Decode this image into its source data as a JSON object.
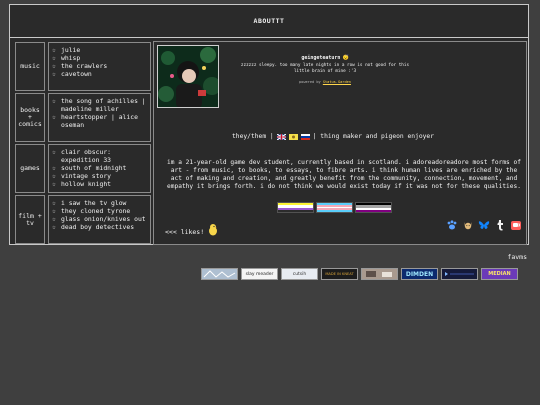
{
  "title": "ABOUTTT",
  "categories": [
    {
      "label": "music",
      "items": [
        "julie",
        "whisp",
        "the crawlers",
        "cavetown"
      ]
    },
    {
      "label": "books + comics",
      "items": [
        "the song of achilles | madeline miller",
        "heartstopper | alice oseman"
      ]
    },
    {
      "label": "games",
      "items": [
        "clair obscur: expedition 33",
        "south of midnight",
        "vintage story",
        "hollow knight"
      ]
    },
    {
      "label": "film + tv",
      "items": [
        "i saw the tv glow",
        "they cloned tyrone",
        "glass onion/knives out",
        "dead boy detectives"
      ]
    }
  ],
  "star_glyph": "☆",
  "status": {
    "username": "geingeteaturn",
    "emoji": "😴",
    "message": "zzzzzz sleepy. too many late nights in a row is not good for this little brain of mine :'3",
    "powered_prefix": "powered by",
    "powered_link": "Status.Garden"
  },
  "pronouns": "they/them |",
  "pronouns_after": "| thing maker and pigeon enjoyer",
  "bio": "im a 21-year-old game dev student, currently based in scotland. i adoreadoreadore most forms of art - from music, to books, to essays, to fibre arts. i think human lives are enriched by the act of making and creation, and greatly benefit from the community, connection, movement, and empathy it brings forth. i do not think we would exist today if it was not for these qualities.",
  "flag_colors": {
    "nonbinary": [
      "#fcf434",
      "#ffffff",
      "#9c59d1",
      "#2c2c2c"
    ],
    "trans": [
      "#5bcefa",
      "#f5a9b8",
      "#ffffff",
      "#f5a9b8",
      "#5bcefa"
    ],
    "ace": [
      "#000000",
      "#a3a3a3",
      "#ffffff",
      "#800080"
    ]
  },
  "socials": [
    "paw-icon",
    "cat-icon",
    "bluesky-icon",
    "tumblr-icon",
    "ko-fi-icon"
  ],
  "likes": "<<< likes!",
  "favs_label": "favms",
  "fav_buttons": [
    "",
    "slay meader",
    "cutsih",
    "MADE IN KNEAT",
    "",
    "DIMDEN",
    "",
    "MEDIAN"
  ]
}
